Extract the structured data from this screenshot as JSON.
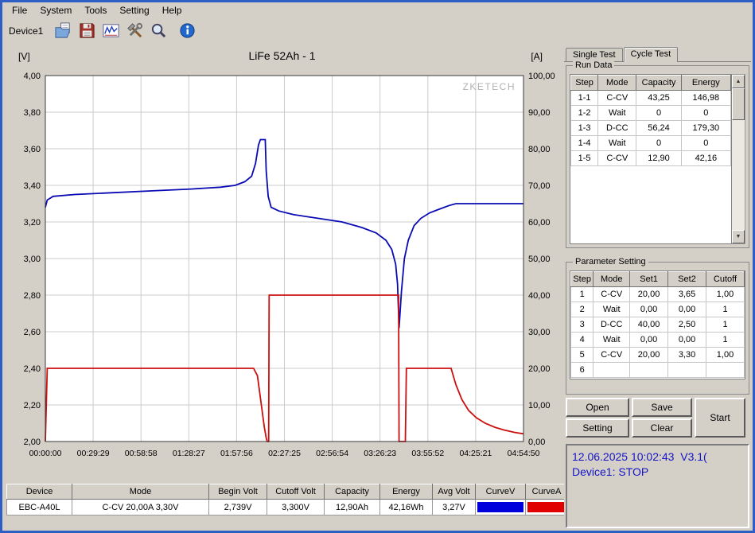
{
  "menu": {
    "items": [
      "File",
      "System",
      "Tools",
      "Setting",
      "Help"
    ]
  },
  "toolbar": {
    "device_label": "Device1",
    "icons": [
      "open-icon",
      "save-icon",
      "wave-icon",
      "tools-icon",
      "zoom-icon",
      "info-icon"
    ]
  },
  "chart_data": {
    "type": "line",
    "title": "LiFe 52Ah - 1",
    "watermark": "ZKETECH",
    "grid": true,
    "x_range_hours": [
      0,
      4.9139
    ],
    "x_ticks": [
      "00:00:00",
      "00:29:29",
      "00:58:58",
      "01:28:27",
      "01:57:56",
      "02:27:25",
      "02:56:54",
      "03:26:23",
      "03:55:52",
      "04:25:21",
      "04:54:50"
    ],
    "left_axis": {
      "unit": "[V]",
      "min": 2.0,
      "max": 4.0,
      "ticks": [
        "4,00",
        "3,80",
        "3,60",
        "3,40",
        "3,20",
        "3,00",
        "2,80",
        "2,60",
        "2,40",
        "2,20",
        "2,00"
      ]
    },
    "right_axis": {
      "unit": "[A]",
      "min": 0,
      "max": 100,
      "ticks": [
        "100,00",
        "90,00",
        "80,00",
        "70,00",
        "60,00",
        "50,00",
        "40,00",
        "30,00",
        "20,00",
        "10,00",
        "0,00"
      ]
    },
    "series": [
      {
        "name": "Voltage (CurveV)",
        "axis": "left",
        "color": "#0a0ab4",
        "points": [
          [
            0,
            3.28
          ],
          [
            0.02,
            3.32
          ],
          [
            0.08,
            3.34
          ],
          [
            0.3,
            3.35
          ],
          [
            0.7,
            3.36
          ],
          [
            1.1,
            3.37
          ],
          [
            1.5,
            3.38
          ],
          [
            1.8,
            3.39
          ],
          [
            1.95,
            3.4
          ],
          [
            2.05,
            3.42
          ],
          [
            2.12,
            3.45
          ],
          [
            2.16,
            3.52
          ],
          [
            2.19,
            3.62
          ],
          [
            2.21,
            3.65
          ],
          [
            2.26,
            3.65
          ],
          [
            2.27,
            3.48
          ],
          [
            2.29,
            3.34
          ],
          [
            2.32,
            3.28
          ],
          [
            2.4,
            3.26
          ],
          [
            2.55,
            3.24
          ],
          [
            2.8,
            3.22
          ],
          [
            3.05,
            3.2
          ],
          [
            3.25,
            3.17
          ],
          [
            3.4,
            3.14
          ],
          [
            3.5,
            3.1
          ],
          [
            3.56,
            3.05
          ],
          [
            3.6,
            2.97
          ],
          [
            3.62,
            2.86
          ],
          [
            3.635,
            2.62
          ],
          [
            3.66,
            2.82
          ],
          [
            3.69,
            3.0
          ],
          [
            3.73,
            3.1
          ],
          [
            3.79,
            3.18
          ],
          [
            3.86,
            3.22
          ],
          [
            3.95,
            3.25
          ],
          [
            4.05,
            3.27
          ],
          [
            4.15,
            3.29
          ],
          [
            4.22,
            3.3
          ],
          [
            4.9139,
            3.3
          ]
        ]
      },
      {
        "name": "Current (CurveA)",
        "axis": "right",
        "color": "#cc0f0f",
        "points": [
          [
            0,
            0
          ],
          [
            0.02,
            20
          ],
          [
            2.14,
            20
          ],
          [
            2.18,
            18
          ],
          [
            2.22,
            10
          ],
          [
            2.25,
            4
          ],
          [
            2.27,
            1
          ],
          [
            2.28,
            0
          ],
          [
            2.295,
            0
          ],
          [
            2.3,
            40
          ],
          [
            3.63,
            40
          ],
          [
            3.635,
            0
          ],
          [
            3.7,
            0
          ],
          [
            3.71,
            20
          ],
          [
            4.17,
            20
          ],
          [
            4.22,
            15.5
          ],
          [
            4.28,
            11.5
          ],
          [
            4.35,
            8.5
          ],
          [
            4.43,
            6.5
          ],
          [
            4.52,
            5
          ],
          [
            4.62,
            3.9
          ],
          [
            4.72,
            3.1
          ],
          [
            4.82,
            2.5
          ],
          [
            4.9139,
            2.1
          ]
        ]
      }
    ]
  },
  "right_panel": {
    "tabs": [
      {
        "label": "Single Test",
        "active": false
      },
      {
        "label": "Cycle Test",
        "active": true
      }
    ],
    "run_data": {
      "group_title": "Run Data",
      "headers": [
        "Step",
        "Mode",
        "Capacity",
        "Energy"
      ],
      "rows": [
        {
          "step": "1-1",
          "mode": "C-CV",
          "capacity": "43,25",
          "energy": "146,98"
        },
        {
          "step": "1-2",
          "mode": "Wait",
          "capacity": "0",
          "energy": "0"
        },
        {
          "step": "1-3",
          "mode": "D-CC",
          "capacity": "56,24",
          "energy": "179,30"
        },
        {
          "step": "1-4",
          "mode": "Wait",
          "capacity": "0",
          "energy": "0"
        },
        {
          "step": "1-5",
          "mode": "C-CV",
          "capacity": "12,90",
          "energy": "42,16"
        }
      ]
    },
    "parameter_setting": {
      "group_title": "Parameter Setting",
      "headers": [
        "Step",
        "Mode",
        "Set1",
        "Set2",
        "Cutoff"
      ],
      "rows": [
        {
          "step": "1",
          "mode": "C-CV",
          "set1": "20,00",
          "set2": "3,65",
          "cutoff": "1,00"
        },
        {
          "step": "2",
          "mode": "Wait",
          "set1": "0,00",
          "set2": "0,00",
          "cutoff": "1"
        },
        {
          "step": "3",
          "mode": "D-CC",
          "set1": "40,00",
          "set2": "2,50",
          "cutoff": "1"
        },
        {
          "step": "4",
          "mode": "Wait",
          "set1": "0,00",
          "set2": "0,00",
          "cutoff": "1"
        },
        {
          "step": "5",
          "mode": "C-CV",
          "set1": "20,00",
          "set2": "3,30",
          "cutoff": "1,00"
        },
        {
          "step": "6",
          "mode": "",
          "set1": "",
          "set2": "",
          "cutoff": ""
        }
      ]
    },
    "buttons": {
      "open": "Open",
      "save": "Save",
      "setting": "Setting",
      "clear": "Clear",
      "start": "Start"
    },
    "status": {
      "line1": "12.06.2025 10:02:43  V3.1(",
      "line2": "Device1: STOP",
      "text_color": "#1414c8"
    }
  },
  "bottom_table": {
    "headers": [
      "Device",
      "Mode",
      "Begin Volt",
      "Cutoff Volt",
      "Capacity",
      "Energy",
      "Avg Volt",
      "CurveV",
      "CurveA"
    ],
    "row": {
      "device": "EBC-A40L",
      "mode": "C-CV 20,00A 3,30V",
      "begin_volt": "2,739V",
      "cutoff_volt": "3,300V",
      "capacity": "12,90Ah",
      "energy": "42,16Wh",
      "avg_volt": "3,27V"
    },
    "curve_v_color": "#0000dc",
    "curve_a_color": "#e00000"
  }
}
